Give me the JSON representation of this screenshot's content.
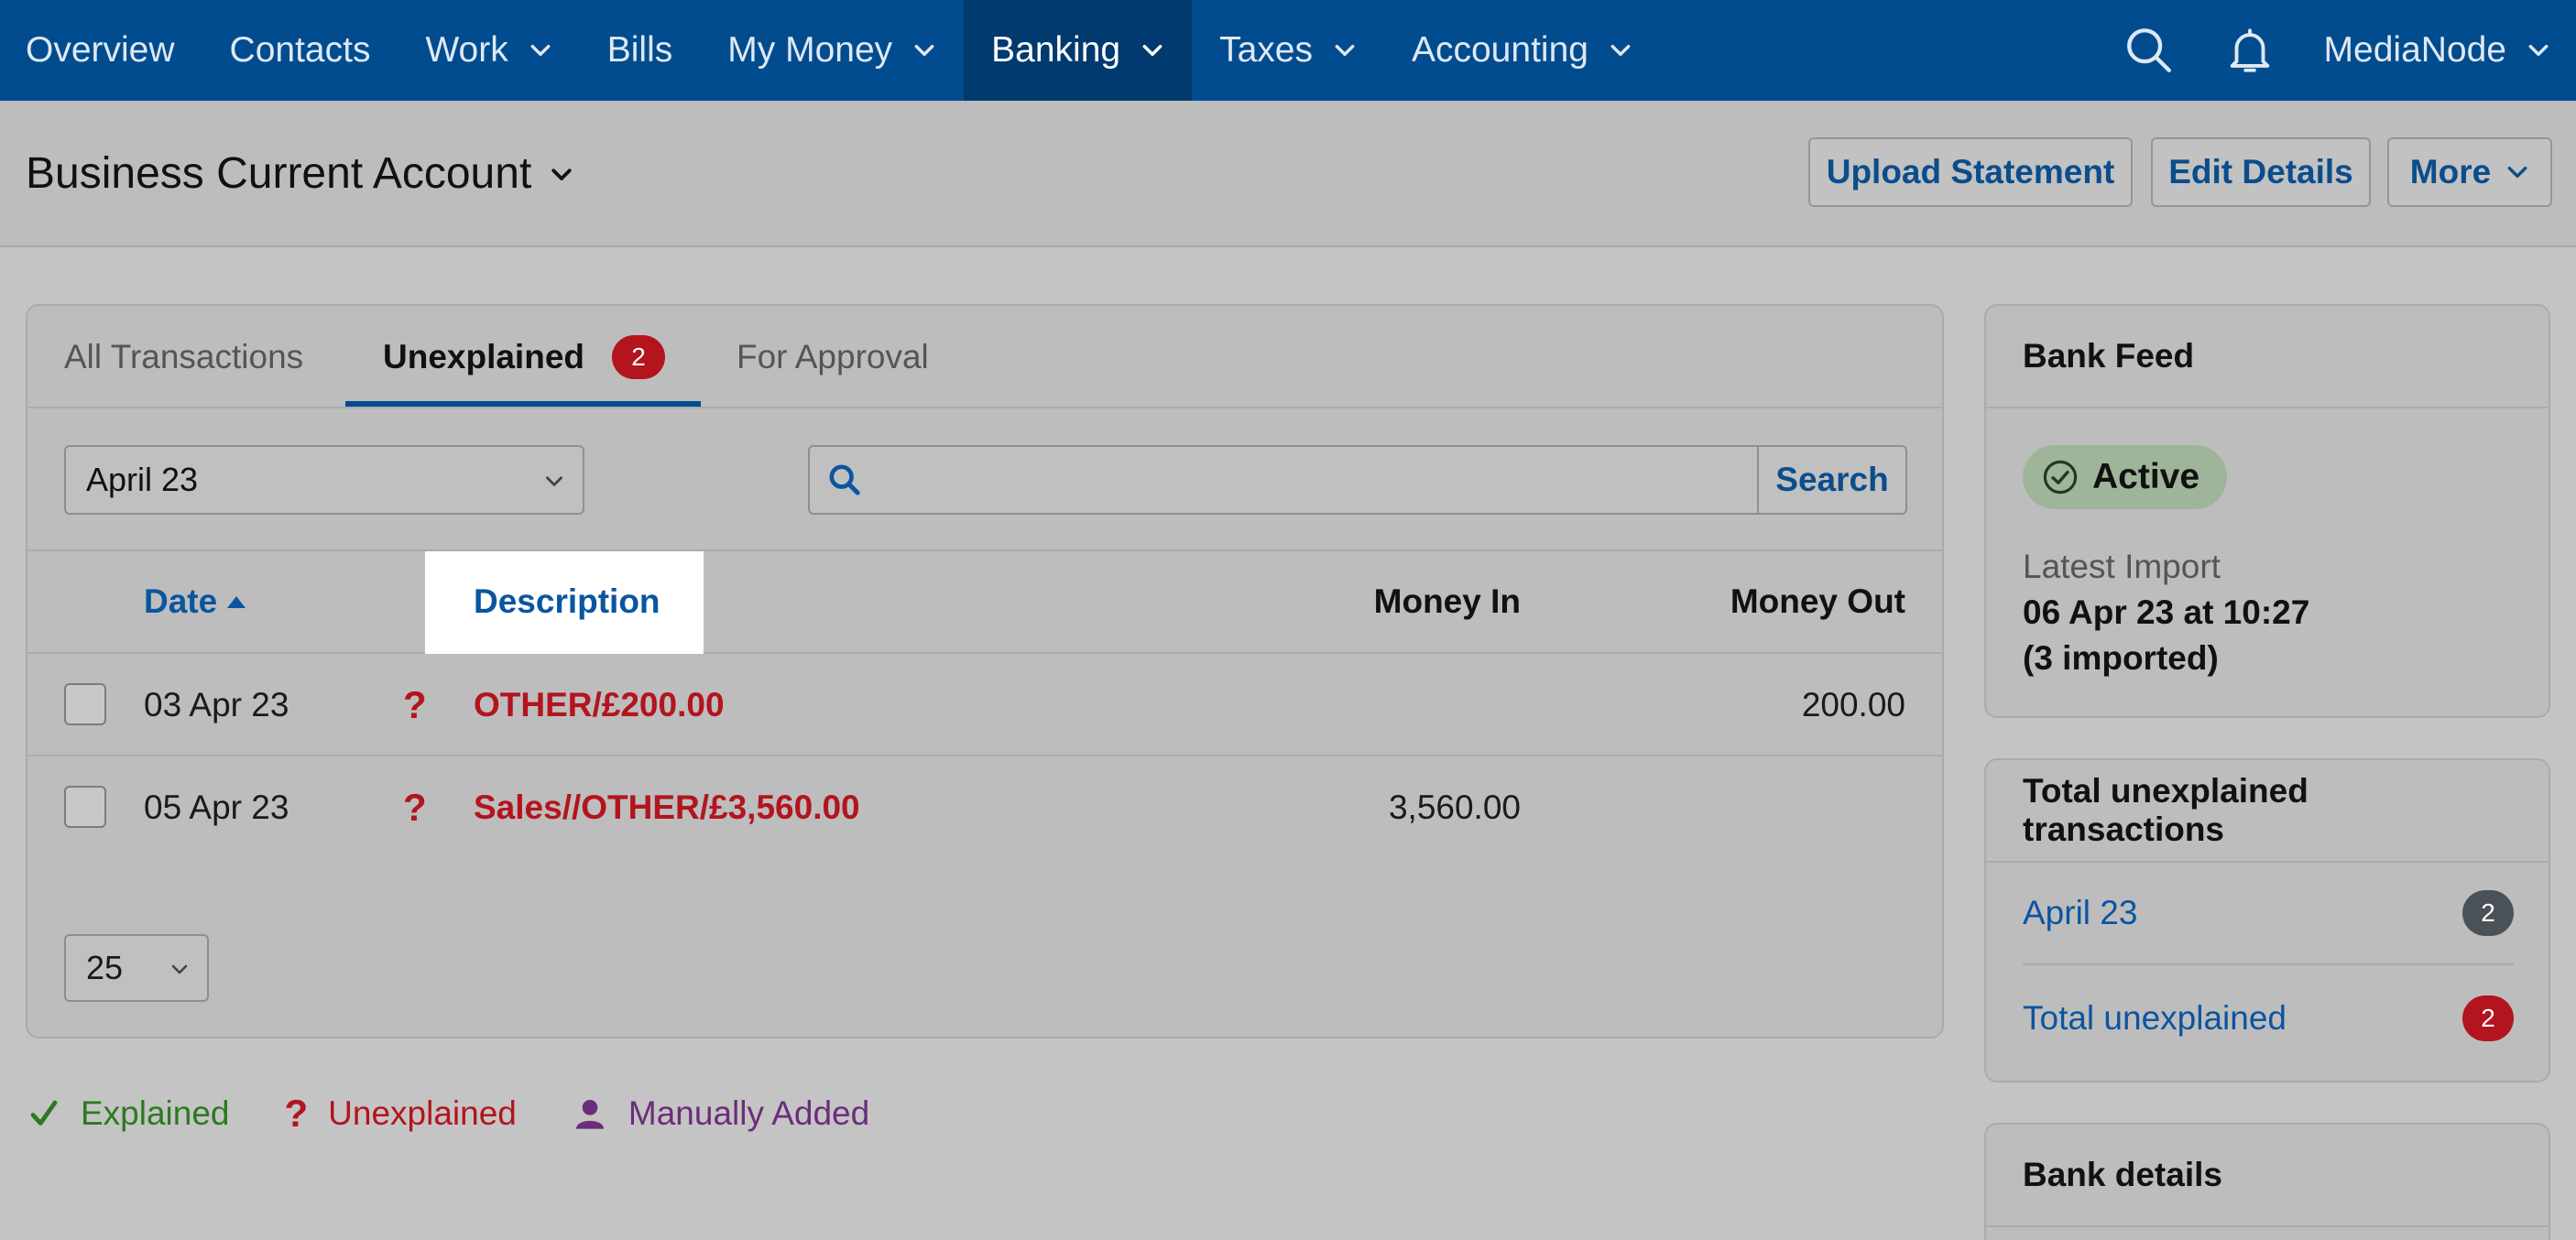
{
  "nav": {
    "items": [
      {
        "label": "Overview",
        "dropdown": false,
        "active": false
      },
      {
        "label": "Contacts",
        "dropdown": false,
        "active": false
      },
      {
        "label": "Work",
        "dropdown": true,
        "active": false
      },
      {
        "label": "Bills",
        "dropdown": false,
        "active": false
      },
      {
        "label": "My Money",
        "dropdown": true,
        "active": false
      },
      {
        "label": "Banking",
        "dropdown": true,
        "active": true
      },
      {
        "label": "Taxes",
        "dropdown": true,
        "active": false
      },
      {
        "label": "Accounting",
        "dropdown": true,
        "active": false
      }
    ],
    "search_icon": "search-icon",
    "notification_icon": "bell-icon",
    "user_label": "MediaNode"
  },
  "header": {
    "title": "Business Current Account",
    "upload_label": "Upload Statement",
    "edit_label": "Edit Details",
    "more_label": "More"
  },
  "tabs": {
    "all": "All Transactions",
    "unexplained": "Unexplained",
    "unexplained_count": "2",
    "approval": "For Approval"
  },
  "filters": {
    "month": "April 23",
    "search_placeholder": "",
    "search_button": "Search"
  },
  "table": {
    "columns": {
      "date": "Date",
      "description": "Description",
      "money_in": "Money In",
      "money_out": "Money Out"
    },
    "rows": [
      {
        "date": "03 Apr 23",
        "status": "?",
        "description": "OTHER/£200.00",
        "money_in": "",
        "money_out": "200.00"
      },
      {
        "date": "05 Apr 23",
        "status": "?",
        "description": "Sales//OTHER/£3,560.00",
        "money_in": "3,560.00",
        "money_out": ""
      }
    ],
    "page_size": "25"
  },
  "legend": {
    "explained": "Explained",
    "unexplained": "Unexplained",
    "manual": "Manually Added",
    "colors": {
      "explained": "#2b7a1f",
      "unexplained": "#b3141e",
      "manual": "#6b2d7b"
    }
  },
  "sidebar": {
    "bank_feed": {
      "title": "Bank Feed",
      "status": "Active",
      "latest_label": "Latest Import",
      "latest_value": "06 Apr 23 at 10:27",
      "imported": "(3 imported)"
    },
    "unexplained": {
      "title": "Total unexplained transactions",
      "month_label": "April 23",
      "month_count": "2",
      "total_label": "Total unexplained",
      "total_count": "2"
    },
    "bank_details": {
      "title": "Bank details"
    }
  },
  "colors": {
    "nav_bg": "#004c8f",
    "link": "#0b55a0",
    "danger": "#b3141e"
  }
}
